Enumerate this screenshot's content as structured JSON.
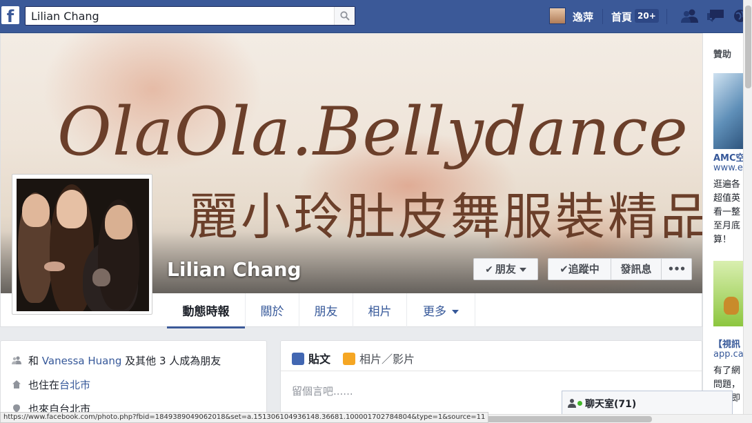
{
  "topbar": {
    "logo": "f",
    "search_value": "Lilian Chang",
    "user_name": "逸萍",
    "home_label": "首頁",
    "home_badge": "20+"
  },
  "cover": {
    "title_line": "OlaOla.Bellydance",
    "subtitle_line": "麗小玲肚皮舞服裝精品"
  },
  "profile": {
    "name": "Lilian Chang",
    "friends_button": "朋友",
    "follow_button": "追蹤中",
    "message_button": "發訊息",
    "more_button": "•••"
  },
  "tabs": [
    {
      "label": "動態時報"
    },
    {
      "label": "關於"
    },
    {
      "label": "朋友"
    },
    {
      "label": "相片"
    },
    {
      "label": "更多"
    }
  ],
  "intro": {
    "row1_prefix": "和 ",
    "row1_link": "Vanessa Huang",
    "row1_suffix": " 及其他 3 人成為朋友",
    "row2_prefix": "也住在",
    "row2_link": "台北市",
    "row3_text": "也來自台北市"
  },
  "composer": {
    "post_label": "貼文",
    "photo_label": "相片／影片",
    "placeholder": "留個言吧......"
  },
  "sidebar": {
    "sponsored_label": "贊助",
    "ad1_title": "AMC空",
    "ad1_url": "www.e",
    "ad1_lines": [
      "逛遍各",
      "超值英",
      "看一整",
      "至月底",
      "算！"
    ],
    "ad2_title": "【視訊",
    "ad2_url": "app.ca",
    "ad2_lines": [
      "有了網",
      "問題，",
      "來，即"
    ]
  },
  "chat": {
    "label": "聊天室(71)"
  },
  "status_url": "https://www.facebook.com/photo.php?fbid=1849389049062018&set=a.151306104936148.36681.100001702784804&type=1&source=11"
}
